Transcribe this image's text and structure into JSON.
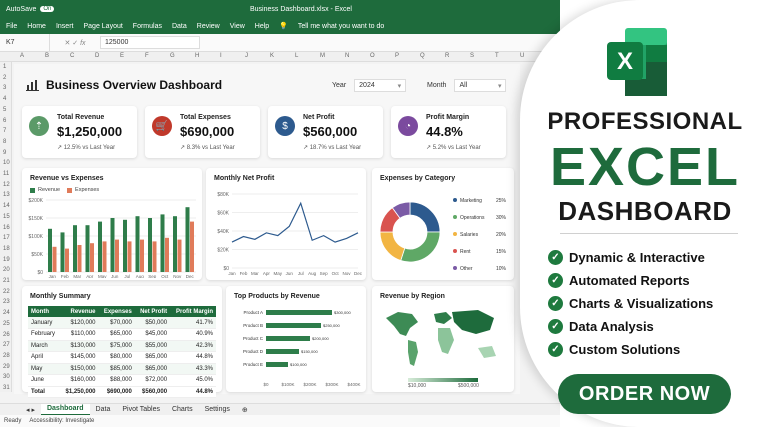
{
  "app": {
    "autosave": "AutoSave",
    "toggle": "On",
    "doc_title": "Business Dashboard.xlsx - Excel"
  },
  "menu": [
    "File",
    "Home",
    "Insert",
    "Page Layout",
    "Formulas",
    "Data",
    "Review",
    "View",
    "Help"
  ],
  "tell_me": "Tell me what you want to do",
  "formula_bar": {
    "cell_ref": "K7",
    "value": "125000"
  },
  "columns": [
    "A",
    "B",
    "C",
    "D",
    "E",
    "F",
    "G",
    "H",
    "I",
    "J",
    "K",
    "L",
    "M",
    "N",
    "O",
    "P",
    "Q",
    "R",
    "S",
    "T",
    "U",
    "V"
  ],
  "rows": [
    "1",
    "2",
    "3",
    "4",
    "5",
    "6",
    "7",
    "8",
    "9",
    "10",
    "11",
    "12",
    "13",
    "14",
    "15",
    "16",
    "17",
    "18",
    "19",
    "20",
    "21",
    "22",
    "23",
    "24",
    "25",
    "26",
    "27",
    "28",
    "29",
    "30",
    "31"
  ],
  "dashboard": {
    "title": "Business Overview Dashboard",
    "year_label": "Year",
    "year_value": "2024",
    "month_label": "Month",
    "month_value": "All",
    "kpis": [
      {
        "label": "Total Revenue",
        "value": "$1,250,000",
        "change": "↗ 12.5% vs Last Year",
        "color": "#5b9a68",
        "icon": "⇡"
      },
      {
        "label": "Total Expenses",
        "value": "$690,000",
        "change": "↗ 8.3% vs Last Year",
        "color": "#c0392b",
        "icon": "🛒"
      },
      {
        "label": "Net Profit",
        "value": "$560,000",
        "change": "↗ 18.7% vs Last Year",
        "color": "#2d5a8e",
        "icon": "$"
      },
      {
        "label": "Profit Margin",
        "value": "44.8%",
        "change": "↗ 5.2% vs Last Year",
        "color": "#7b4a9e",
        "icon": "◔"
      }
    ]
  },
  "chart_data": [
    {
      "type": "bar",
      "title": "Revenue vs Expenses",
      "legend": [
        "Revenue",
        "Expenses"
      ],
      "categories": [
        "Jan",
        "Feb",
        "Mar",
        "Apr",
        "May",
        "Jun",
        "Jul",
        "Aug",
        "Sep",
        "Oct",
        "Nov",
        "Dec"
      ],
      "series": [
        {
          "name": "Revenue",
          "values": [
            120,
            110,
            130,
            130,
            140,
            150,
            145,
            155,
            150,
            160,
            155,
            180
          ],
          "color": "#2e7d4a"
        },
        {
          "name": "Expenses",
          "values": [
            70,
            65,
            75,
            80,
            85,
            90,
            85,
            90,
            85,
            95,
            90,
            140
          ],
          "color": "#e07b5a"
        }
      ],
      "yticks": [
        "$0",
        "$50K",
        "$100K",
        "$150K",
        "$200K"
      ],
      "ylim": [
        0,
        200
      ]
    },
    {
      "type": "line",
      "title": "Monthly Net Profit",
      "categories": [
        "Jan",
        "Feb",
        "Mar",
        "Apr",
        "May",
        "Jun",
        "Jul",
        "Aug",
        "Sep",
        "Oct",
        "Nov",
        "Dec"
      ],
      "values": [
        28,
        34,
        31,
        38,
        35,
        45,
        70,
        30,
        35,
        28,
        32,
        38
      ],
      "yticks": [
        "$0",
        "$20K",
        "$40K",
        "$60K",
        "$80K"
      ],
      "ylim": [
        0,
        80
      ]
    },
    {
      "type": "pie",
      "title": "Expenses by Category",
      "slices": [
        {
          "label": "Marketing",
          "value": 25,
          "text": "25%",
          "color": "#2d5a8e"
        },
        {
          "label": "Operations",
          "value": 30,
          "text": "30%",
          "color": "#5fa866"
        },
        {
          "label": "Salaries",
          "value": 20,
          "text": "20%",
          "color": "#f2b543"
        },
        {
          "label": "Rent",
          "value": 15,
          "text": "15%",
          "color": "#d9534f"
        },
        {
          "label": "Other",
          "value": 10,
          "text": "10%",
          "color": "#7b5ba6"
        }
      ]
    },
    {
      "type": "bar",
      "title": "Top Products by Revenue",
      "orientation": "horizontal",
      "categories": [
        "Product A",
        "Product B",
        "Product C",
        "Product D",
        "Product E"
      ],
      "values": [
        300000,
        250000,
        200000,
        150000,
        100000
      ],
      "labels": [
        "$300,000",
        "$250,000",
        "$200,000",
        "$150,000",
        "$100,000"
      ],
      "xticks": [
        "$0",
        "$100K",
        "$200K",
        "$300K",
        "$400K"
      ],
      "xlim": [
        0,
        400000
      ]
    }
  ],
  "summary": {
    "title": "Monthly Summary",
    "headers": [
      "Month",
      "Revenue",
      "Expenses",
      "Net Profit",
      "Profit Margin"
    ],
    "rows": [
      [
        "January",
        "$120,000",
        "$70,000",
        "$50,000",
        "41.7%"
      ],
      [
        "February",
        "$110,000",
        "$65,000",
        "$45,000",
        "40.9%"
      ],
      [
        "March",
        "$130,000",
        "$75,000",
        "$55,000",
        "42.3%"
      ],
      [
        "April",
        "$145,000",
        "$80,000",
        "$65,000",
        "44.8%"
      ],
      [
        "May",
        "$150,000",
        "$85,000",
        "$65,000",
        "43.3%"
      ],
      [
        "June",
        "$160,000",
        "$88,000",
        "$72,000",
        "45.0%"
      ]
    ],
    "total": [
      "Total",
      "$1,250,000",
      "$690,000",
      "$560,000",
      "44.8%"
    ]
  },
  "region": {
    "title": "Revenue by Region",
    "scale_min": "$10,000",
    "scale_max": "$500,000"
  },
  "sheets": [
    "Dashboard",
    "Data",
    "Pivot Tables",
    "Charts",
    "Settings"
  ],
  "status": {
    "ready": "Ready",
    "accessibility": "Accessibility: Investigate"
  },
  "promo": {
    "line1": "PROFESSIONAL",
    "line2": "EXCEL",
    "line3": "DASHBOARD",
    "features": [
      "Dynamic & Interactive",
      "Automated Reports",
      "Charts & Visualizations",
      "Data Analysis",
      "Custom Solutions"
    ],
    "cta": "ORDER NOW",
    "logo_letter": "X"
  },
  "colors": {
    "excel_green": "#1e6b3c",
    "accent_green": "#1e7a3e"
  }
}
